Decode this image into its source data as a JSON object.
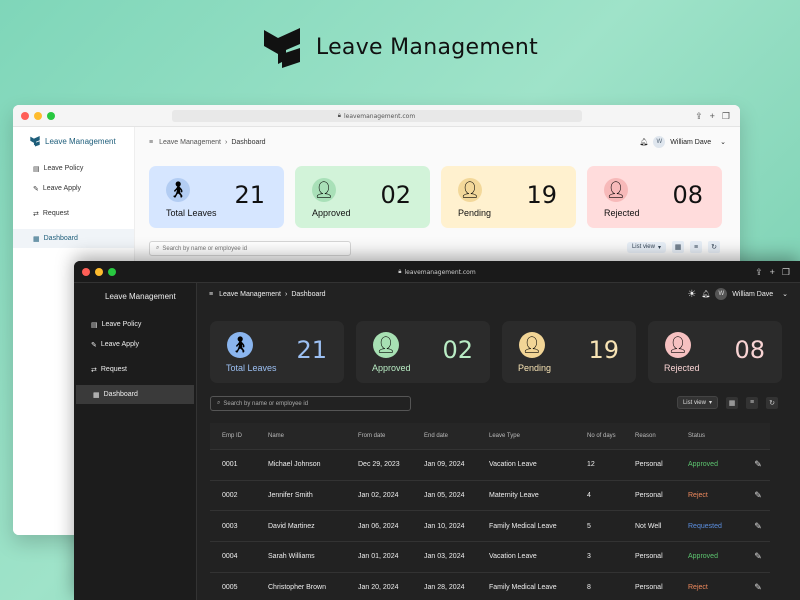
{
  "hero": {
    "title": "Leave Management"
  },
  "browser": {
    "url": "leavemanagement.com"
  },
  "app": {
    "brand": "Leave Management"
  },
  "nav": {
    "items": [
      {
        "label": "Leave Policy",
        "icon": "policy-icon"
      },
      {
        "label": "Leave Apply",
        "icon": "apply-icon"
      },
      {
        "label": "Request",
        "icon": "request-icon"
      },
      {
        "label": "Dashboard",
        "icon": "dashboard-grid-icon"
      }
    ]
  },
  "breadcrumb": {
    "root": "Leave Management",
    "current": "Dashboard"
  },
  "user": {
    "name": "William Dave",
    "initial": "W"
  },
  "stats": [
    {
      "label": "Total Leaves",
      "value": "21"
    },
    {
      "label": "Approved",
      "value": "02"
    },
    {
      "label": "Pending",
      "value": "19"
    },
    {
      "label": "Rejected",
      "value": "08"
    }
  ],
  "search": {
    "placeholder": "Search by name or employee id"
  },
  "view": {
    "label": "List view"
  },
  "table": {
    "headers": [
      "Emp ID",
      "Name",
      "From date",
      "End date",
      "Leave Type",
      "No of days",
      "Reason",
      "Status"
    ],
    "rows": [
      {
        "id": "0001",
        "name": "Michael Johnson",
        "from": "Dec 29, 2023",
        "to": "Jan 09, 2024",
        "type": "Vacation Leave",
        "days": "12",
        "reason": "Personal",
        "status": "Approved"
      },
      {
        "id": "0002",
        "name": "Jennifer Smith",
        "from": "Jan 02, 2024",
        "to": "Jan 05, 2024",
        "type": "Maternity Leave",
        "days": "4",
        "reason": "Personal",
        "status": "Reject"
      },
      {
        "id": "0003",
        "name": "David Martinez",
        "from": "Jan 06, 2024",
        "to": "Jan 10, 2024",
        "type": "Family Medical Leave",
        "days": "5",
        "reason": "Not Well",
        "status": "Requested"
      },
      {
        "id": "0004",
        "name": "Sarah Williams",
        "from": "Jan 01, 2024",
        "to": "Jan 03, 2024",
        "type": "Vacation Leave",
        "days": "3",
        "reason": "Personal",
        "status": "Approved"
      },
      {
        "id": "0005",
        "name": "Christopher Brown",
        "from": "Jan 20, 2024",
        "to": "Jan 28, 2024",
        "type": "Family Medical Leave",
        "days": "8",
        "reason": "Personal",
        "status": "Reject"
      }
    ]
  },
  "colors": {
    "approved": "#5cc46f",
    "reject": "#f08a5d",
    "requested": "#5b8fe0",
    "brand": "#1d5d7a"
  }
}
